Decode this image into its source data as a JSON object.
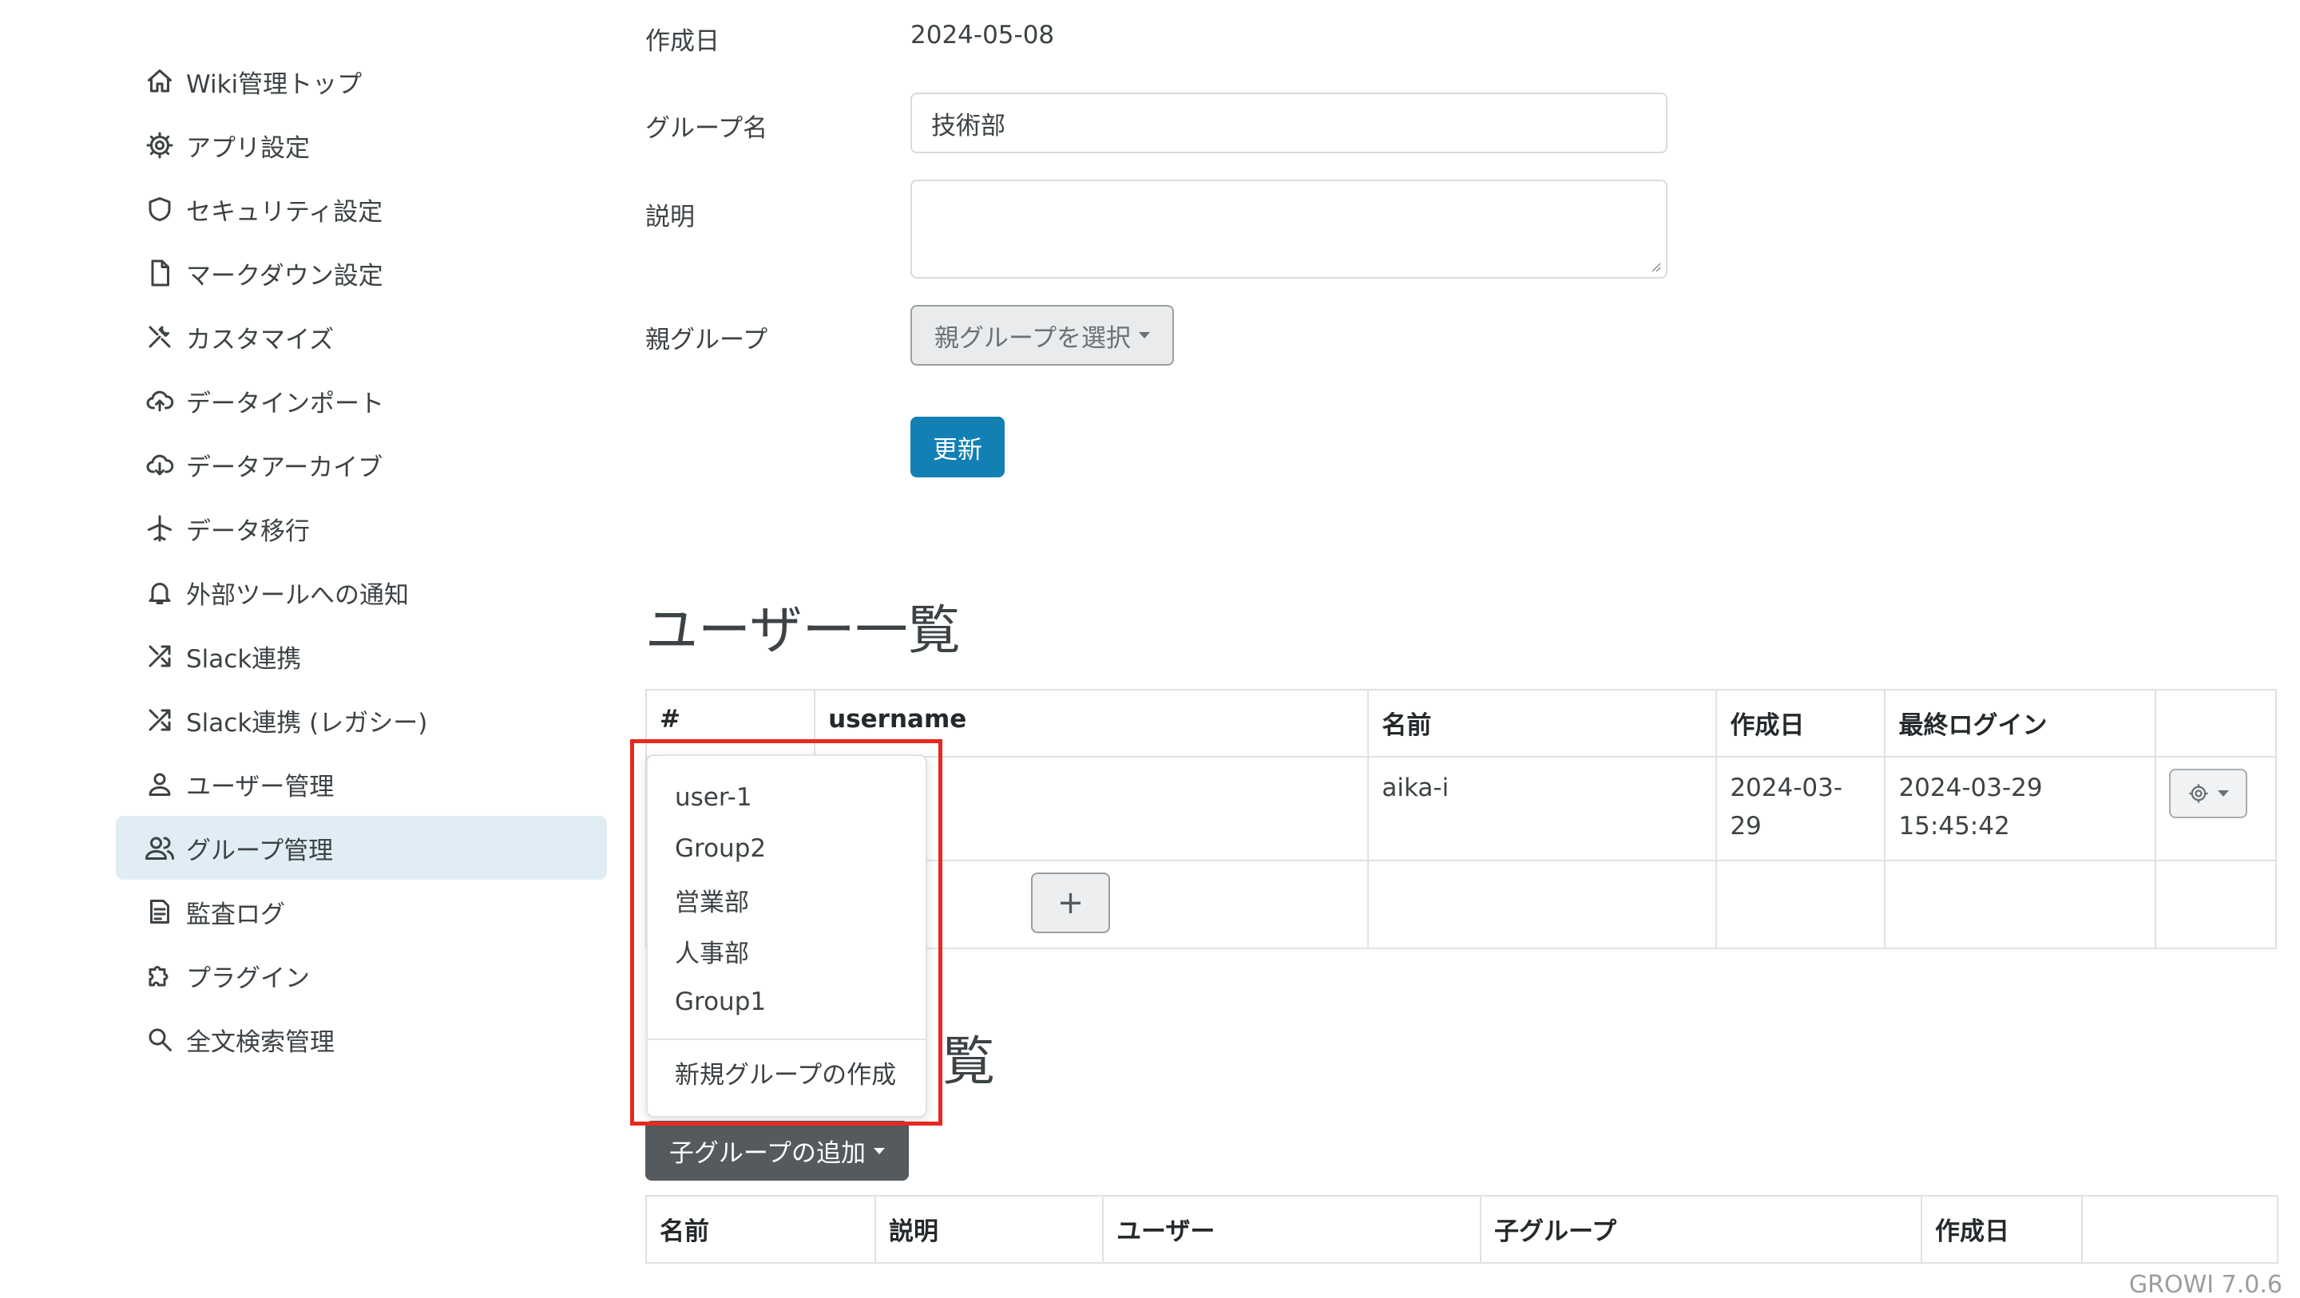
{
  "sidebar": {
    "items": [
      {
        "label": "Wiki管理トップ",
        "icon": "home-icon"
      },
      {
        "label": "アプリ設定",
        "icon": "gear-icon"
      },
      {
        "label": "セキュリティ設定",
        "icon": "shield-icon"
      },
      {
        "label": "マークダウン設定",
        "icon": "file-icon"
      },
      {
        "label": "カスタマイズ",
        "icon": "tools-icon"
      },
      {
        "label": "データインポート",
        "icon": "cloud-upload-icon"
      },
      {
        "label": "データアーカイブ",
        "icon": "cloud-download-icon"
      },
      {
        "label": "データ移行",
        "icon": "airplane-icon"
      },
      {
        "label": "外部ツールへの通知",
        "icon": "bell-icon"
      },
      {
        "label": "Slack連携",
        "icon": "shuffle-icon"
      },
      {
        "label": "Slack連携 (レガシー)",
        "icon": "shuffle-icon"
      },
      {
        "label": "ユーザー管理",
        "icon": "user-icon"
      },
      {
        "label": "グループ管理",
        "icon": "users-icon",
        "active": true
      },
      {
        "label": "監査ログ",
        "icon": "log-icon"
      },
      {
        "label": "プラグイン",
        "icon": "puzzle-icon"
      },
      {
        "label": "全文検索管理",
        "icon": "search-icon"
      }
    ]
  },
  "form": {
    "created_label": "作成日",
    "created_value": "2024-05-08",
    "group_name_label": "グループ名",
    "group_name_value": "技術部",
    "description_label": "説明",
    "description_value": "",
    "parent_group_label": "親グループ",
    "parent_group_select": "親グループを選択",
    "update_button": "更新"
  },
  "users_section": {
    "title": "ユーザー一覧",
    "columns": [
      "#",
      "username",
      "名前",
      "作成日",
      "最終ログイン",
      ""
    ],
    "rows": [
      {
        "num": "",
        "username": "",
        "name": "aika-i",
        "created": "2024-03-29",
        "last_login": "2024-03-29 15:45:42"
      }
    ],
    "add_button": "+"
  },
  "dropdown": {
    "items": [
      "user-1",
      "Group2",
      "営業部",
      "人事部",
      "Group1"
    ],
    "create_new": "新規グループの作成"
  },
  "child_groups_section": {
    "title_visible": "覧",
    "add_child_button": "子グループの追加",
    "columns": [
      "名前",
      "説明",
      "ユーザー",
      "子グループ",
      "作成日",
      ""
    ]
  },
  "footer": {
    "version": "GROWI 7.0.6"
  },
  "colors": {
    "primary": "#1380b4",
    "active_nav": "#e0edf5",
    "highlight": "#e8291f",
    "dark_button": "#545a5d"
  }
}
